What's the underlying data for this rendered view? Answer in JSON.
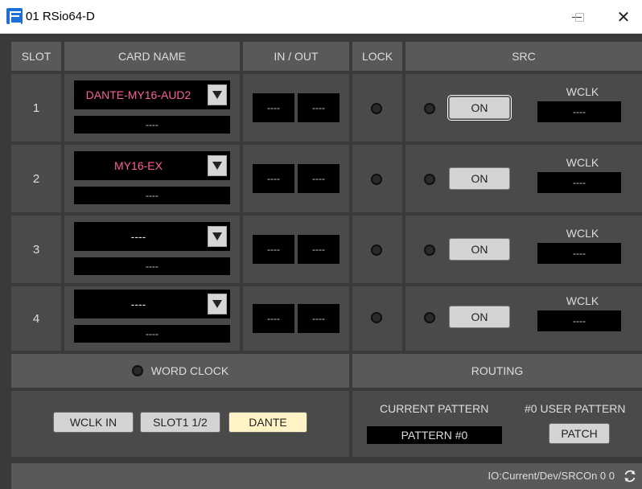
{
  "window": {
    "title": "01 RSio64-D",
    "close_glyph": "✕"
  },
  "table": {
    "headers": {
      "slot": "SLOT",
      "card_name": "CARD NAME",
      "in_out": "IN / OUT",
      "lock": "LOCK",
      "src": "SRC"
    },
    "rows": [
      {
        "slot": "1",
        "card_name": "DANTE-MY16-AUD2",
        "card_sub": "----",
        "in": "----",
        "out": "----",
        "src_on": "ON",
        "wclk_label": "WCLK",
        "wclk_value": "----"
      },
      {
        "slot": "2",
        "card_name": "MY16-EX",
        "card_sub": "----",
        "in": "----",
        "out": "----",
        "src_on": "ON",
        "wclk_label": "WCLK",
        "wclk_value": "----"
      },
      {
        "slot": "3",
        "card_name": "----",
        "card_sub": "----",
        "in": "----",
        "out": "----",
        "src_on": "ON",
        "wclk_label": "WCLK",
        "wclk_value": "----"
      },
      {
        "slot": "4",
        "card_name": "----",
        "card_sub": "----",
        "in": "----",
        "out": "----",
        "src_on": "ON",
        "wclk_label": "WCLK",
        "wclk_value": "----"
      }
    ]
  },
  "word_clock": {
    "title": "WORD CLOCK",
    "buttons": {
      "wclk_in": "WCLK IN",
      "slot1": "SLOT1 1/2",
      "dante": "DANTE"
    },
    "selected": "DANTE"
  },
  "routing": {
    "title": "ROUTING",
    "current_pattern_label": "CURRENT PATTERN",
    "current_pattern_value": "PATTERN #0",
    "user_pattern_label": "#0 USER PATTERN",
    "patch_label": "PATCH"
  },
  "status": {
    "text": "IO:Current/Dev/SRCOn 0 0"
  },
  "colors": {
    "accent_pink": "#ff5d9a",
    "active_button": "#fff4c6",
    "panel": "#4a4a4a",
    "header": "#595959"
  },
  "icons": {
    "app": "app-logo-icon",
    "minimize": "minimize-icon",
    "maximize": "maximize-icon",
    "close": "close-icon",
    "refresh": "refresh-icon",
    "dropdown": "chevron-down-icon"
  }
}
